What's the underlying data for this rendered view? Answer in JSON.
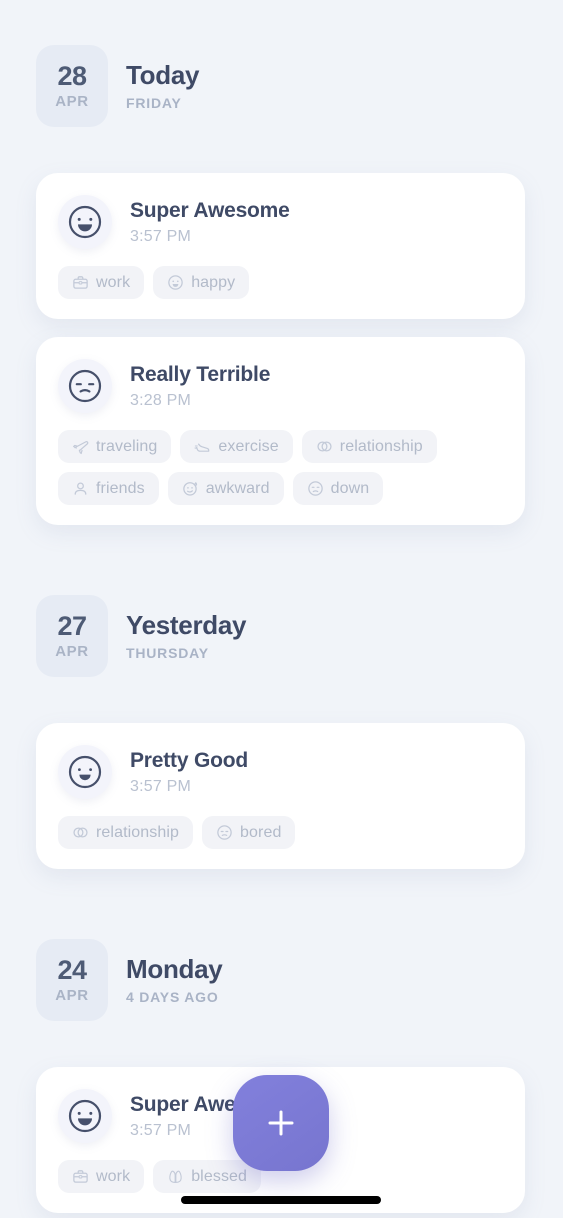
{
  "app": {
    "background_color": "#f1f4f9",
    "accent_color": "#7f7cd9",
    "card_color": "#ffffff",
    "title_color": "#3f4a66",
    "muted_color": "#b2bac9"
  },
  "groups": [
    {
      "day_number": "28",
      "month": "APR",
      "title": "Today",
      "subtitle": "FRIDAY",
      "entries": [
        {
          "mood": "Super Awesome",
          "mood_face": "grin-face",
          "time": "3:57 PM",
          "tags": [
            {
              "label": "work",
              "icon": "briefcase-icon"
            },
            {
              "label": "happy",
              "icon": "smiley-face-icon"
            }
          ]
        },
        {
          "mood": "Really Terrible",
          "mood_face": "frown-face",
          "time": "3:28 PM",
          "tags": [
            {
              "label": "traveling",
              "icon": "airplane-icon"
            },
            {
              "label": "exercise",
              "icon": "running-shoe-icon"
            },
            {
              "label": "relationship",
              "icon": "linked-rings-icon"
            },
            {
              "label": "friends",
              "icon": "person-icon"
            },
            {
              "label": "awkward",
              "icon": "sweating-face-icon"
            },
            {
              "label": "down",
              "icon": "sad-face-icon"
            }
          ]
        }
      ]
    },
    {
      "day_number": "27",
      "month": "APR",
      "title": "Yesterday",
      "subtitle": "THURSDAY",
      "entries": [
        {
          "mood": "Pretty Good",
          "mood_face": "smile-face",
          "time": "3:57 PM",
          "tags": [
            {
              "label": "relationship",
              "icon": "linked-rings-icon"
            },
            {
              "label": "bored",
              "icon": "neutral-face-icon"
            }
          ]
        }
      ]
    },
    {
      "day_number": "24",
      "month": "APR",
      "title": "Monday",
      "subtitle": "4 DAYS AGO",
      "entries": [
        {
          "mood": "Super Awesome",
          "mood_face": "grin-face",
          "time": "3:57 PM",
          "tags": [
            {
              "label": "work",
              "icon": "briefcase-icon"
            },
            {
              "label": "blessed",
              "icon": "praying-hands-icon"
            }
          ]
        }
      ]
    }
  ],
  "fab": {
    "label": "+",
    "icon": "plus-icon"
  }
}
